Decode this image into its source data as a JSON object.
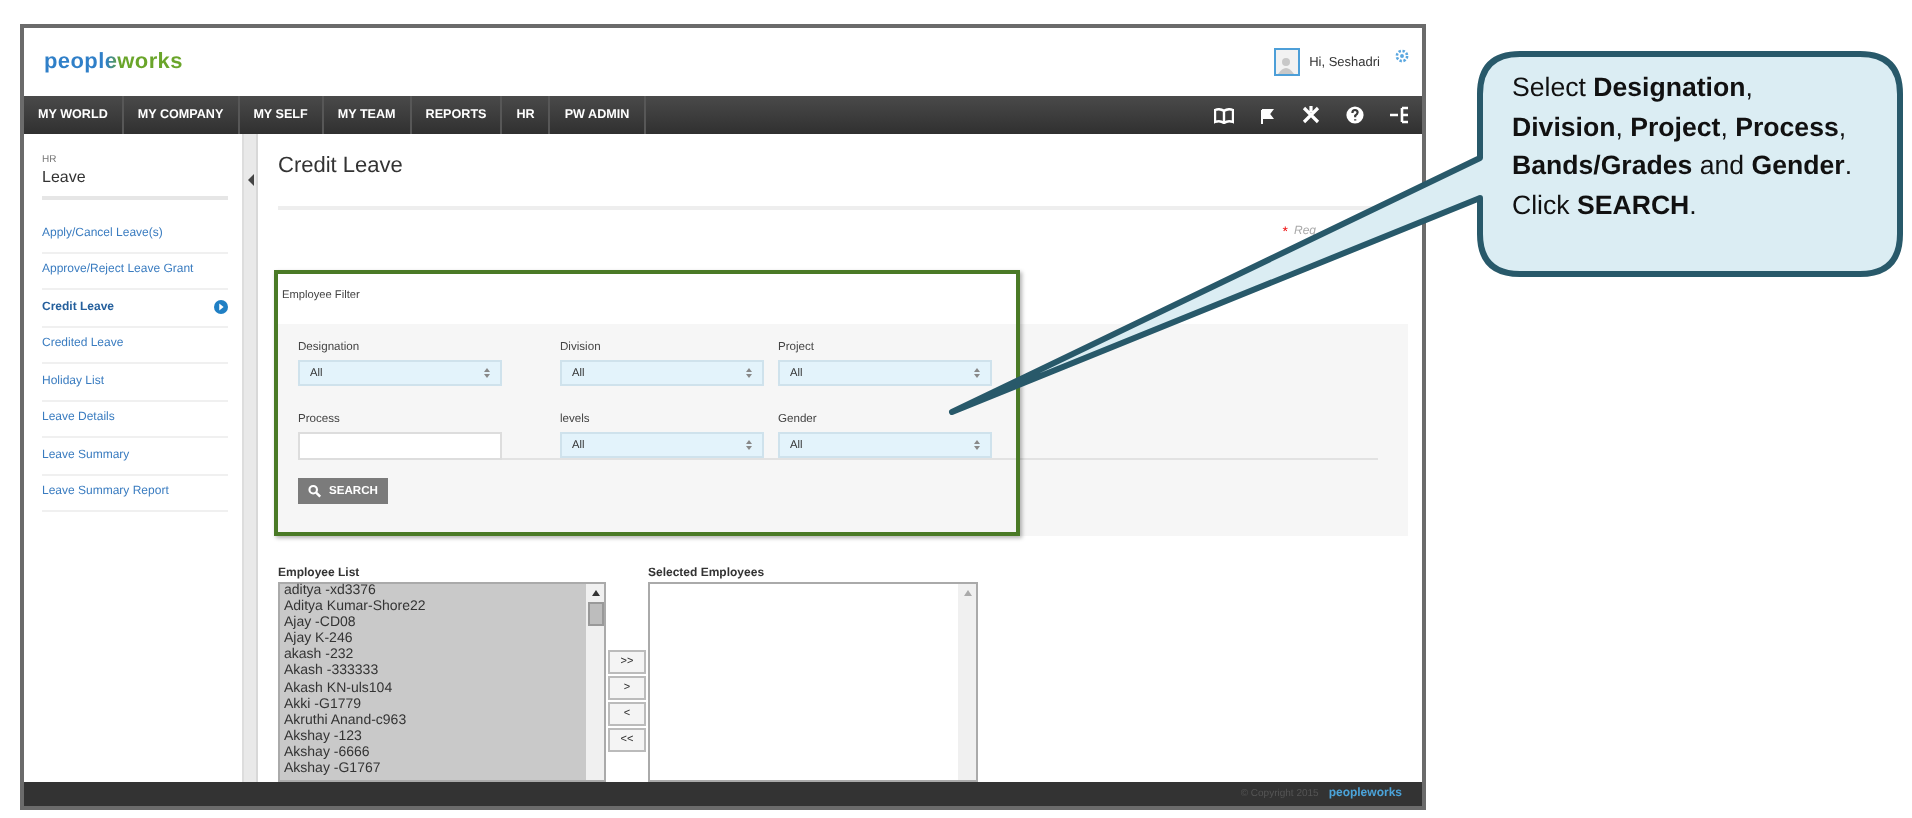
{
  "header": {
    "logo": "peopleworks",
    "greeting": "Hi, Seshadri"
  },
  "nav": {
    "items": [
      {
        "label": "MY WORLD"
      },
      {
        "label": "MY COMPANY"
      },
      {
        "label": "MY SELF"
      },
      {
        "label": "MY TEAM"
      },
      {
        "label": "REPORTS"
      },
      {
        "label": "HR"
      },
      {
        "label": "PW ADMIN"
      }
    ]
  },
  "sidebar": {
    "section": "HR",
    "title": "Leave",
    "items": [
      {
        "label": "Apply/Cancel Leave(s)",
        "selected": false
      },
      {
        "label": "Approve/Reject Leave Grant",
        "selected": false
      },
      {
        "label": "Credit Leave",
        "selected": true
      },
      {
        "label": "Credited Leave",
        "selected": false
      },
      {
        "label": "Holiday List",
        "selected": false
      },
      {
        "label": "Leave Details",
        "selected": false
      },
      {
        "label": "Leave Summary",
        "selected": false
      },
      {
        "label": "Leave Summary Report",
        "selected": false
      }
    ]
  },
  "page": {
    "title": "Credit Leave",
    "required_mark": "*",
    "required_note": "Req"
  },
  "filter": {
    "title": "Employee Filter",
    "fields": [
      {
        "label": "Designation",
        "kind": "select",
        "value": "All"
      },
      {
        "label": "Division",
        "kind": "select",
        "value": "All"
      },
      {
        "label": "Project",
        "kind": "select",
        "value": "All"
      },
      {
        "label": "Process",
        "kind": "text"
      },
      {
        "label": "levels",
        "kind": "select",
        "value": "All"
      },
      {
        "label": "Gender",
        "kind": "select",
        "value": "All"
      }
    ],
    "search_button": "SEARCH"
  },
  "employee_list": {
    "label": "Employee List",
    "items": [
      "aditya -xd3376",
      "Aditya Kumar-Shore22",
      "Ajay -CD08",
      "Ajay K-246",
      "akash -232",
      "Akash -333333",
      "Akash KN-uls104",
      "Akki -G1779",
      "Akruthi Anand-c963",
      "Akshay -123",
      "Akshay -6666",
      "Akshay -G1767"
    ]
  },
  "transfer_buttons": [
    ">>",
    ">",
    "<",
    "<<"
  ],
  "selected_employees": {
    "label": "Selected Employees"
  },
  "footer": {
    "copyright": "© Copyright 2015",
    "logo": "peopleworks"
  },
  "callout": {
    "text": "Select **Designation**, **Division**, **Project**, **Process**, **Bands/Grades** and **Gender**. Click **SEARCH**."
  }
}
